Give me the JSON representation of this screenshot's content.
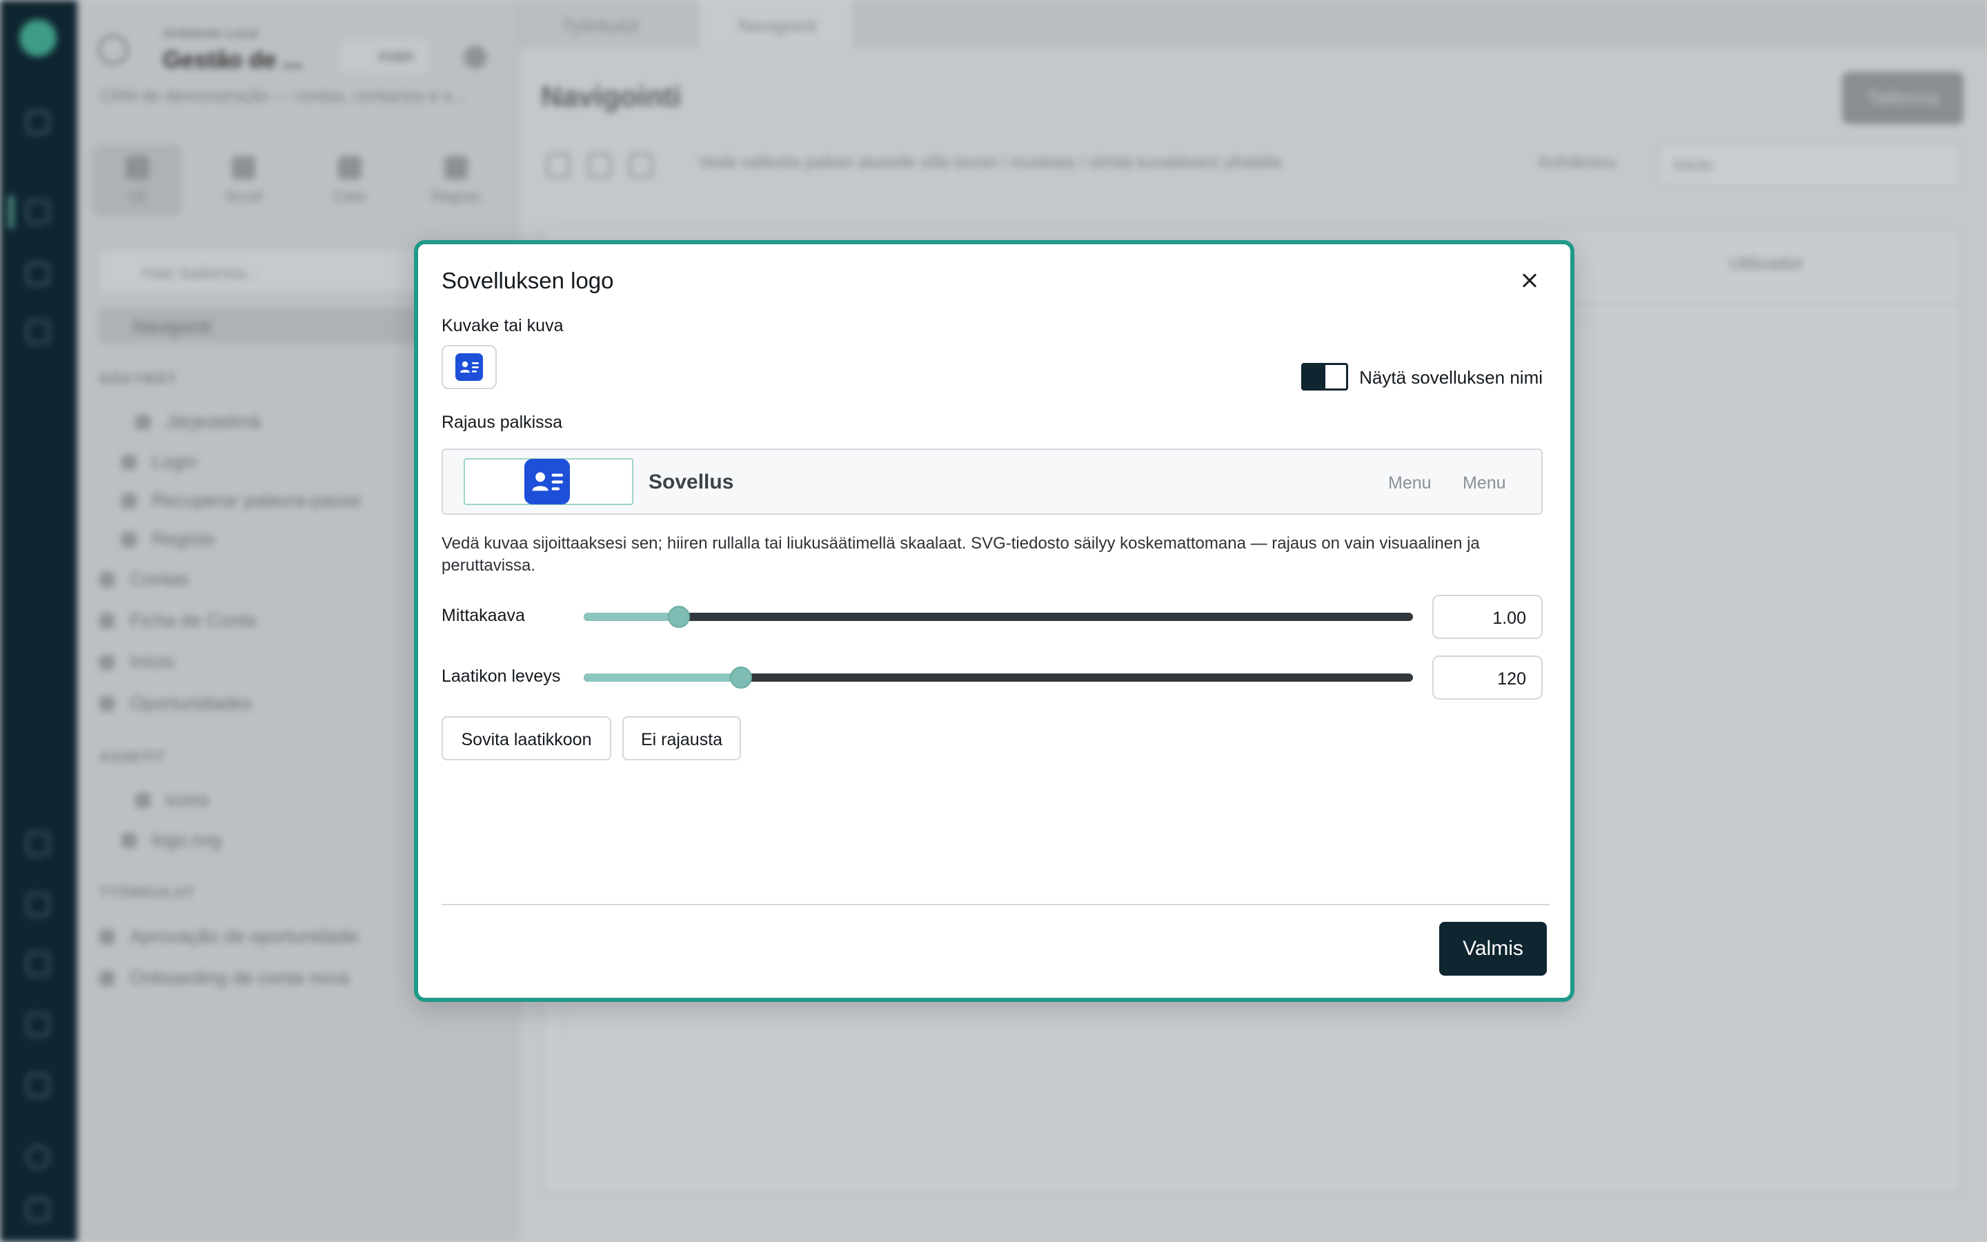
{
  "background": {
    "sidebar": {
      "workspace_small": "Ambiente Local",
      "workspace_title": "Gestão de ...",
      "branch": "main",
      "description": "CRM de demonstração — contas, contactos e o...",
      "tabs": [
        "UI",
        "Scroll",
        "Data",
        "Regras"
      ],
      "search_placeholder": "Hae kaikesta...",
      "active_nav": "Navigointi",
      "sections": {
        "pages": "NÄKYMÄT",
        "assets": "ASSETIT",
        "workflows": "TYÖNKULUT"
      },
      "pages": [
        "Järjestelmä",
        "Login",
        "Recuperar palavra-passe",
        "Registo",
        "Contas",
        "Ficha de Conta",
        "Início",
        "Oportunidades"
      ],
      "assets": [
        "icons",
        "logo.svg"
      ],
      "workflows": [
        "Aprovação de oportunidade",
        "Onboarding de conta nova"
      ]
    },
    "tabs": [
      "Työnkulut",
      "Navigointi"
    ],
    "page_title": "Navigointi",
    "publish_label": "Tallenna",
    "toolbar_hint": "Vedä valikoita paikan alueelle sillä tavoin / muokata / siirtää kuvakkeesi ylhäältä",
    "target_label": "Kohdesivu",
    "target_value": "Inicio",
    "user_chip": "Utilizador"
  },
  "modal": {
    "title": "Sovelluksen logo",
    "close_label": "Sulje",
    "icon_label": "Kuvake tai kuva",
    "toggle_label": "Näytä sovelluksen nimi",
    "toggle_on": true,
    "crop_label": "Rajaus palkissa",
    "preview": {
      "app_name": "Sovellus",
      "menu_items": [
        "Menu",
        "Menu"
      ]
    },
    "help_text": "Vedä kuvaa sijoittaaksesi sen; hiiren rullalla tai liukusäätimellä skaalaat. SVG-tiedosto säilyy koskemattomana — rajaus on vain visuaalinen ja peruttavissa.",
    "scale": {
      "label": "Mittakaava",
      "value": "1.00",
      "fraction": 0.115
    },
    "box_width": {
      "label": "Laatikon leveys",
      "value": "120",
      "fraction": 0.19
    },
    "fit_button": "Sovita laatikkoon",
    "no_crop_button": "Ei rajausta",
    "done_button": "Valmis"
  },
  "colors": {
    "accent": "#1f9a88",
    "primary": "#0f2530",
    "icon_blue": "#1d4fd8",
    "slider_fill": "#8bc5bd"
  },
  "icons": {
    "app": "contact-card-icon",
    "close": "close-icon"
  }
}
